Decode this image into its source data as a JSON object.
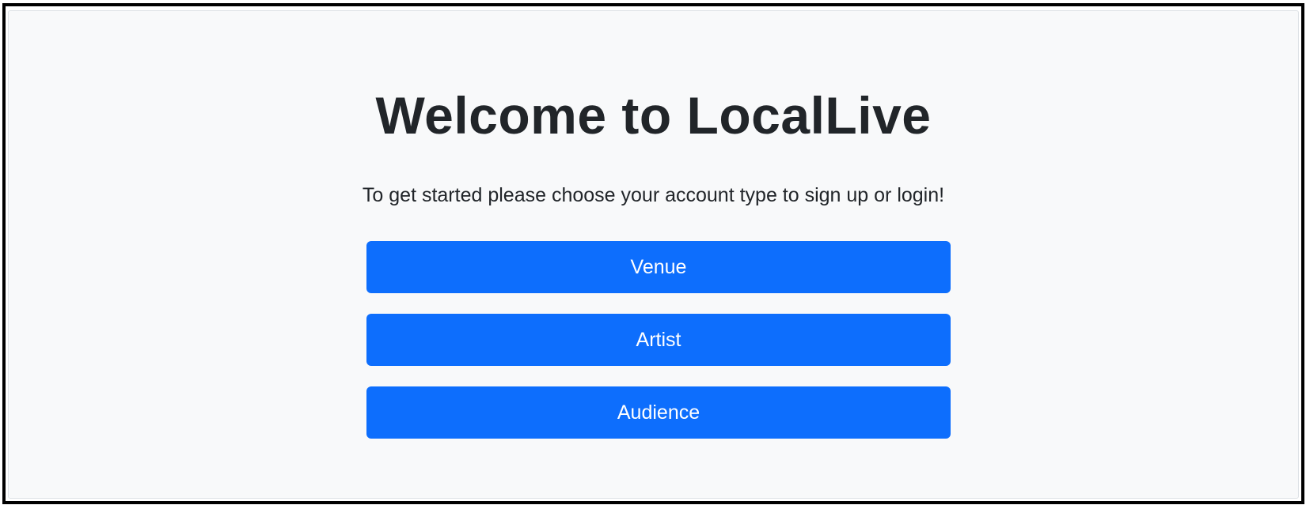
{
  "header": {
    "title": "Welcome to LocalLive",
    "subtitle": "To get started please choose your account type to sign up or login!"
  },
  "account_types": [
    {
      "label": "Venue"
    },
    {
      "label": "Artist"
    },
    {
      "label": "Audience"
    }
  ],
  "colors": {
    "primary": "#0d6efd",
    "background": "#f8f9fa",
    "text": "#212529",
    "button_text": "#ffffff"
  }
}
